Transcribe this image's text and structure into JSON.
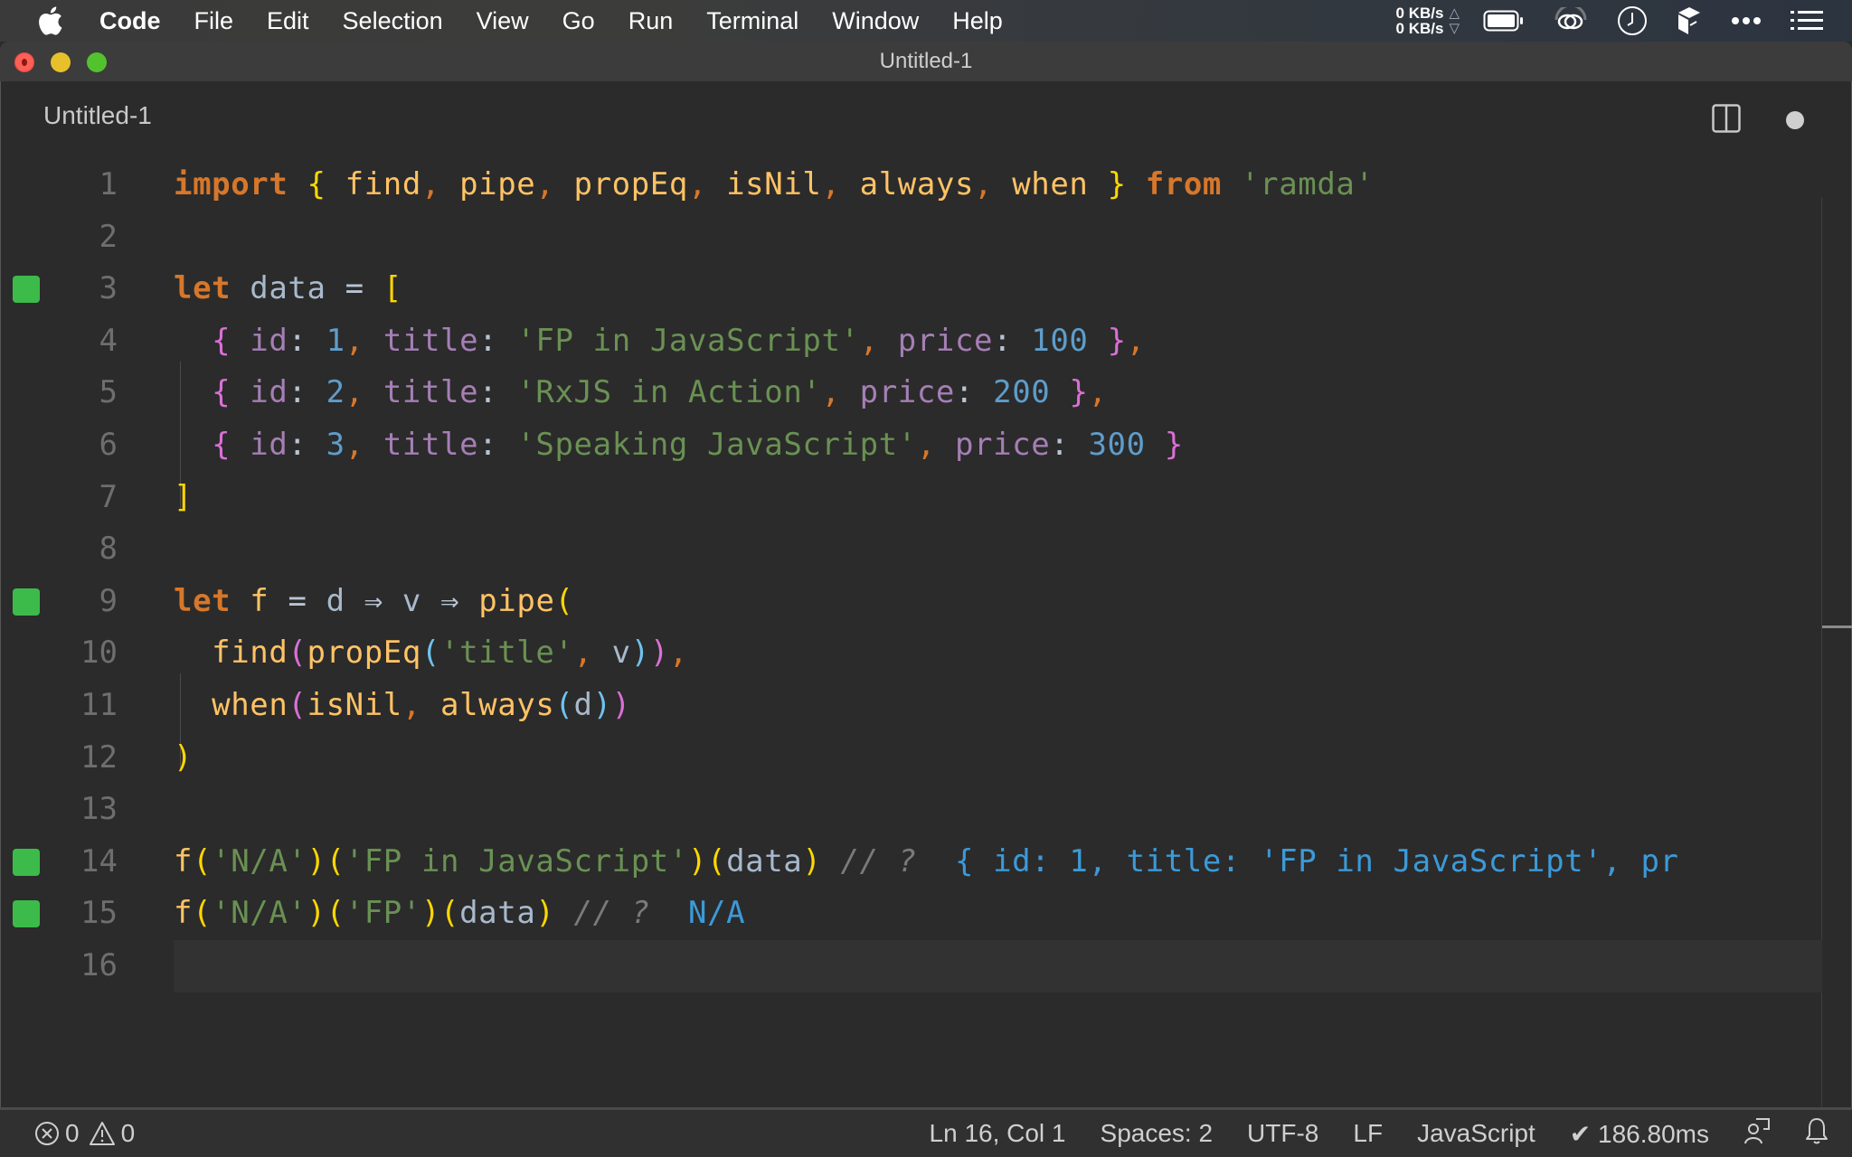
{
  "menubar": {
    "apple_icon": "apple-icon",
    "items": [
      "Code",
      "File",
      "Edit",
      "Selection",
      "View",
      "Go",
      "Run",
      "Terminal",
      "Window",
      "Help"
    ],
    "tray": {
      "upload_rate": "0 KB/s",
      "download_rate": "0 KB/s",
      "icons": [
        "battery-icon",
        "creative-cloud-icon",
        "clock-icon",
        "dropbox-icon",
        "more-icon",
        "control-center-list-icon"
      ]
    }
  },
  "window": {
    "title": "Untitled-1",
    "tab_label": "Untitled-1",
    "split_editor_icon": "split-editor-icon",
    "unsaved_indicator": "dirty-dot"
  },
  "editor": {
    "current_line": 16,
    "lines": [
      {
        "n": "1",
        "marker": false,
        "tokens": [
          [
            "kw",
            "import"
          ],
          [
            "sp",
            " "
          ],
          [
            "br1",
            "{"
          ],
          [
            "sp",
            " "
          ],
          [
            "fn",
            "find"
          ],
          [
            "pun",
            ","
          ],
          [
            "sp",
            " "
          ],
          [
            "fn",
            "pipe"
          ],
          [
            "pun",
            ","
          ],
          [
            "sp",
            " "
          ],
          [
            "fn",
            "propEq"
          ],
          [
            "pun",
            ","
          ],
          [
            "sp",
            " "
          ],
          [
            "fn",
            "isNil"
          ],
          [
            "pun",
            ","
          ],
          [
            "sp",
            " "
          ],
          [
            "fn",
            "always"
          ],
          [
            "pun",
            ","
          ],
          [
            "sp",
            " "
          ],
          [
            "fn",
            "when"
          ],
          [
            "sp",
            " "
          ],
          [
            "br1",
            "}"
          ],
          [
            "sp",
            " "
          ],
          [
            "kw",
            "from"
          ],
          [
            "sp",
            " "
          ],
          [
            "str",
            "'ramda'"
          ]
        ]
      },
      {
        "n": "2",
        "marker": false,
        "tokens": []
      },
      {
        "n": "3",
        "marker": true,
        "tokens": [
          [
            "kw",
            "let"
          ],
          [
            "sp",
            " "
          ],
          [
            "var",
            "data"
          ],
          [
            "sp",
            " "
          ],
          [
            "op",
            "="
          ],
          [
            "sp",
            " "
          ],
          [
            "br1",
            "["
          ]
        ]
      },
      {
        "n": "4",
        "marker": false,
        "tokens": [
          [
            "sp",
            "  "
          ],
          [
            "br2",
            "{"
          ],
          [
            "sp",
            " "
          ],
          [
            "prop",
            "id"
          ],
          [
            "col",
            ":"
          ],
          [
            "sp",
            " "
          ],
          [
            "num",
            "1"
          ],
          [
            "pun",
            ","
          ],
          [
            "sp",
            " "
          ],
          [
            "prop",
            "title"
          ],
          [
            "col",
            ":"
          ],
          [
            "sp",
            " "
          ],
          [
            "str",
            "'FP in JavaScript'"
          ],
          [
            "pun",
            ","
          ],
          [
            "sp",
            " "
          ],
          [
            "prop",
            "price"
          ],
          [
            "col",
            ":"
          ],
          [
            "sp",
            " "
          ],
          [
            "num",
            "100"
          ],
          [
            "sp",
            " "
          ],
          [
            "br2",
            "}"
          ],
          [
            "pun",
            ","
          ]
        ]
      },
      {
        "n": "5",
        "marker": false,
        "tokens": [
          [
            "sp",
            "  "
          ],
          [
            "br2",
            "{"
          ],
          [
            "sp",
            " "
          ],
          [
            "prop",
            "id"
          ],
          [
            "col",
            ":"
          ],
          [
            "sp",
            " "
          ],
          [
            "num",
            "2"
          ],
          [
            "pun",
            ","
          ],
          [
            "sp",
            " "
          ],
          [
            "prop",
            "title"
          ],
          [
            "col",
            ":"
          ],
          [
            "sp",
            " "
          ],
          [
            "str",
            "'RxJS in Action'"
          ],
          [
            "pun",
            ","
          ],
          [
            "sp",
            " "
          ],
          [
            "prop",
            "price"
          ],
          [
            "col",
            ":"
          ],
          [
            "sp",
            " "
          ],
          [
            "num",
            "200"
          ],
          [
            "sp",
            " "
          ],
          [
            "br2",
            "}"
          ],
          [
            "pun",
            ","
          ]
        ]
      },
      {
        "n": "6",
        "marker": false,
        "tokens": [
          [
            "sp",
            "  "
          ],
          [
            "br2",
            "{"
          ],
          [
            "sp",
            " "
          ],
          [
            "prop",
            "id"
          ],
          [
            "col",
            ":"
          ],
          [
            "sp",
            " "
          ],
          [
            "num",
            "3"
          ],
          [
            "pun",
            ","
          ],
          [
            "sp",
            " "
          ],
          [
            "prop",
            "title"
          ],
          [
            "col",
            ":"
          ],
          [
            "sp",
            " "
          ],
          [
            "str",
            "'Speaking JavaScript'"
          ],
          [
            "pun",
            ","
          ],
          [
            "sp",
            " "
          ],
          [
            "prop",
            "price"
          ],
          [
            "col",
            ":"
          ],
          [
            "sp",
            " "
          ],
          [
            "num",
            "300"
          ],
          [
            "sp",
            " "
          ],
          [
            "br2",
            "}"
          ]
        ]
      },
      {
        "n": "7",
        "marker": false,
        "tokens": [
          [
            "br1",
            "]"
          ]
        ]
      },
      {
        "n": "8",
        "marker": false,
        "tokens": []
      },
      {
        "n": "9",
        "marker": true,
        "tokens": [
          [
            "kw",
            "let"
          ],
          [
            "sp",
            " "
          ],
          [
            "fn",
            "f"
          ],
          [
            "sp",
            " "
          ],
          [
            "op",
            "="
          ],
          [
            "sp",
            " "
          ],
          [
            "var",
            "d"
          ],
          [
            "sp",
            " "
          ],
          [
            "op",
            "⇒"
          ],
          [
            "sp",
            " "
          ],
          [
            "var",
            "v"
          ],
          [
            "sp",
            " "
          ],
          [
            "op",
            "⇒"
          ],
          [
            "sp",
            " "
          ],
          [
            "fn",
            "pipe"
          ],
          [
            "br1",
            "("
          ]
        ]
      },
      {
        "n": "10",
        "marker": false,
        "tokens": [
          [
            "sp",
            "  "
          ],
          [
            "fn",
            "find"
          ],
          [
            "br2",
            "("
          ],
          [
            "fn",
            "propEq"
          ],
          [
            "br3",
            "("
          ],
          [
            "str",
            "'title'"
          ],
          [
            "pun",
            ","
          ],
          [
            "sp",
            " "
          ],
          [
            "var",
            "v"
          ],
          [
            "br3",
            ")"
          ],
          [
            "br2",
            ")"
          ],
          [
            "pun",
            ","
          ]
        ]
      },
      {
        "n": "11",
        "marker": false,
        "tokens": [
          [
            "sp",
            "  "
          ],
          [
            "fn",
            "when"
          ],
          [
            "br2",
            "("
          ],
          [
            "fn",
            "isNil"
          ],
          [
            "pun",
            ","
          ],
          [
            "sp",
            " "
          ],
          [
            "fn",
            "always"
          ],
          [
            "br3",
            "("
          ],
          [
            "var",
            "d"
          ],
          [
            "br3",
            ")"
          ],
          [
            "br2",
            ")"
          ]
        ]
      },
      {
        "n": "12",
        "marker": false,
        "tokens": [
          [
            "br1",
            ")"
          ]
        ]
      },
      {
        "n": "13",
        "marker": false,
        "tokens": []
      },
      {
        "n": "14",
        "marker": true,
        "tokens": [
          [
            "fn",
            "f"
          ],
          [
            "br1",
            "("
          ],
          [
            "str",
            "'N/A'"
          ],
          [
            "br1",
            ")"
          ],
          [
            "br1",
            "("
          ],
          [
            "str",
            "'FP in JavaScript'"
          ],
          [
            "br1",
            ")"
          ],
          [
            "br1",
            "("
          ],
          [
            "var",
            "data"
          ],
          [
            "br1",
            ")"
          ],
          [
            "sp",
            " "
          ],
          [
            "cmt",
            "// ?"
          ],
          [
            "sp",
            "  "
          ],
          [
            "res",
            "{ id: 1, title: 'FP in JavaScript', pr"
          ]
        ]
      },
      {
        "n": "15",
        "marker": true,
        "tokens": [
          [
            "fn",
            "f"
          ],
          [
            "br1",
            "("
          ],
          [
            "str",
            "'N/A'"
          ],
          [
            "br1",
            ")"
          ],
          [
            "br1",
            "("
          ],
          [
            "str",
            "'FP'"
          ],
          [
            "br1",
            ")"
          ],
          [
            "br1",
            "("
          ],
          [
            "var",
            "data"
          ],
          [
            "br1",
            ")"
          ],
          [
            "sp",
            " "
          ],
          [
            "cmt",
            "// ?"
          ],
          [
            "sp",
            "  "
          ],
          [
            "res",
            "N/A"
          ]
        ]
      },
      {
        "n": "16",
        "marker": false,
        "tokens": []
      }
    ]
  },
  "statusbar": {
    "errors": "0",
    "warnings": "0",
    "cursor": "Ln 16, Col 1",
    "indent": "Spaces: 2",
    "encoding": "UTF-8",
    "eol": "LF",
    "language": "JavaScript",
    "quokka_time": "✔ 186.80ms",
    "feedback_icon": "feedback-icon",
    "notifications_icon": "bell-icon"
  }
}
